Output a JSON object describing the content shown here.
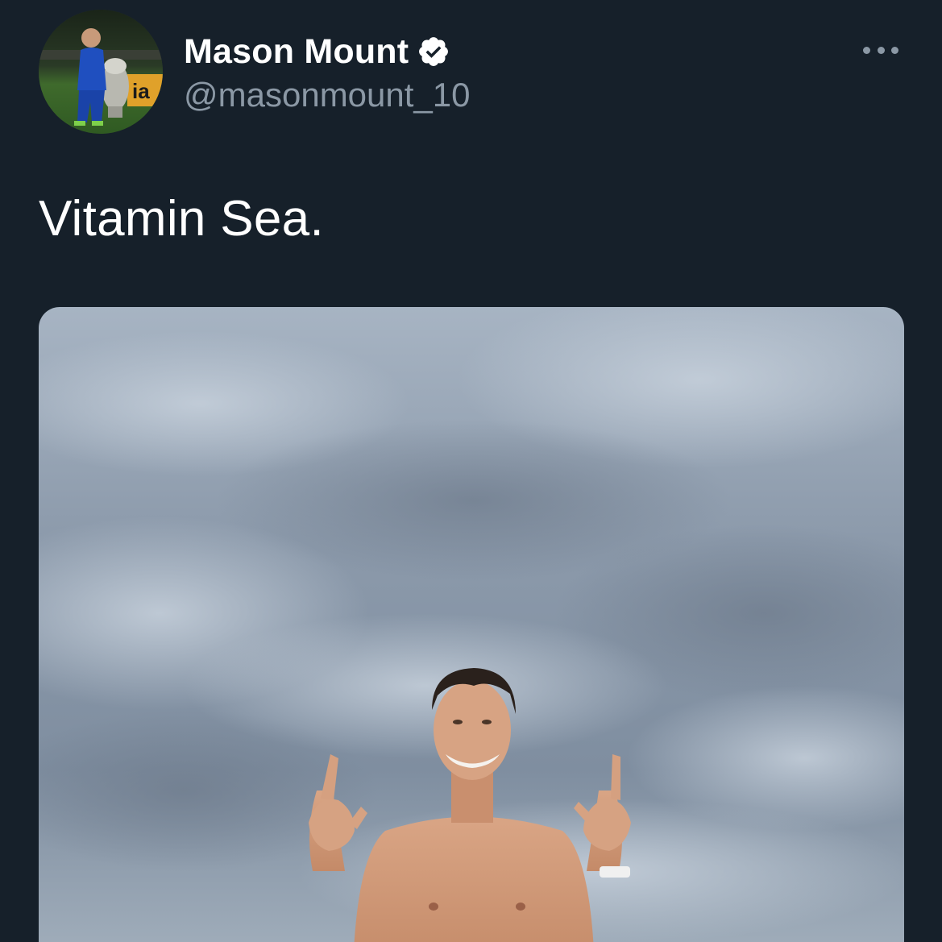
{
  "author": {
    "display_name": "Mason Mount",
    "handle": "@masonmount_10",
    "verified": true,
    "avatar_icon": "avatar-photo",
    "verified_icon": "verified-badge-icon"
  },
  "tweet": {
    "text": "Vitamin Sea.",
    "more_icon": "more-options-icon",
    "media_description_icon": "photo"
  },
  "colors": {
    "background": "#16202a",
    "text_primary": "#ffffff",
    "text_secondary": "#8b98a5"
  }
}
